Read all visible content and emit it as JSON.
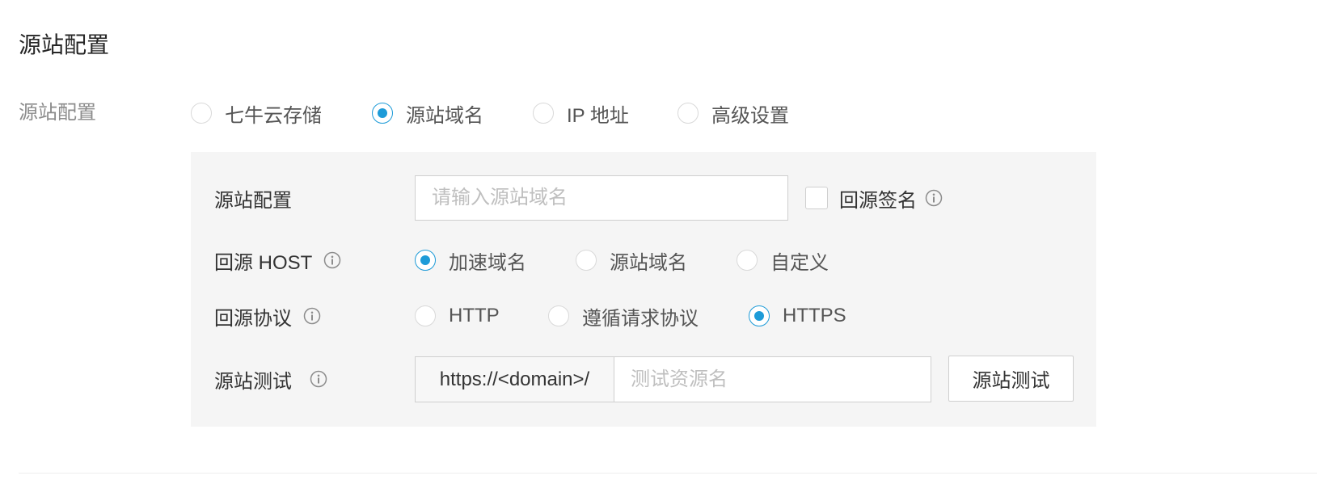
{
  "section_title": "源站配置",
  "origin_type": {
    "label": "源站配置",
    "options": [
      {
        "label": "七牛云存储",
        "checked": false
      },
      {
        "label": "源站域名",
        "checked": true
      },
      {
        "label": "IP 地址",
        "checked": false
      },
      {
        "label": "高级设置",
        "checked": false
      }
    ]
  },
  "panel": {
    "origin": {
      "label": "源站配置",
      "input_value": "",
      "input_placeholder": "请输入源站域名",
      "signature_checkbox_label": "回源签名",
      "signature_checked": false
    },
    "host": {
      "label": "回源 HOST",
      "options": [
        {
          "label": "加速域名",
          "checked": true
        },
        {
          "label": "源站域名",
          "checked": false
        },
        {
          "label": "自定义",
          "checked": false
        }
      ]
    },
    "protocol": {
      "label": "回源协议",
      "options": [
        {
          "label": "HTTP",
          "checked": false
        },
        {
          "label": "遵循请求协议",
          "checked": false
        },
        {
          "label": "HTTPS",
          "checked": true
        }
      ]
    },
    "test": {
      "label": "源站测试",
      "prefix": "https://<domain>/",
      "input_value": "",
      "input_placeholder": "测试资源名",
      "button_label": "源站测试"
    }
  },
  "icons": {
    "info": "info-circle-icon"
  },
  "colors": {
    "accent": "#1d9bd8",
    "panel_bg": "#f5f5f5"
  }
}
